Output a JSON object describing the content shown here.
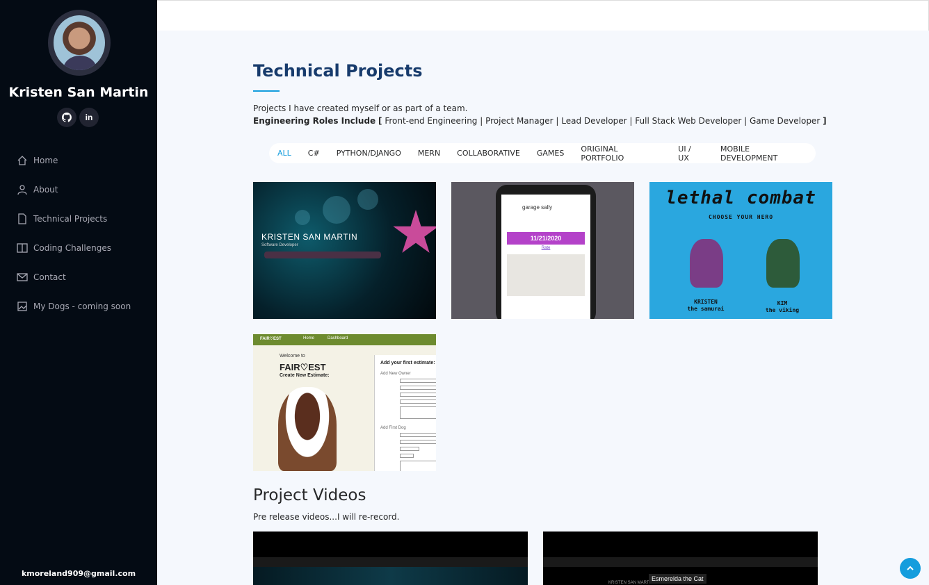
{
  "sidebar": {
    "name": "Kristen San Martin",
    "social": {
      "github": "⌂",
      "linkedin": "in"
    },
    "nav": [
      {
        "label": "Home",
        "icon": "home-icon"
      },
      {
        "label": "About",
        "icon": "person-icon"
      },
      {
        "label": "Technical Projects",
        "icon": "file-icon"
      },
      {
        "label": "Coding Challenges",
        "icon": "book-icon"
      },
      {
        "label": "Contact",
        "icon": "envelope-icon"
      },
      {
        "label": "My Dogs - coming soon",
        "icon": "images-icon"
      }
    ],
    "email": "kmoreland909@gmail.com"
  },
  "main": {
    "title": "Technical Projects",
    "description": "Projects I have created myself or as part of a team.",
    "roles_label": "Engineering Roles Include",
    "roles_text": "Front-end Engineering | Project Manager | Lead Developer | Full Stack Web Developer | Game Developer",
    "filters": [
      "ALL",
      "C#",
      "PYTHON/DJANGO",
      "MERN",
      "COLLABORATIVE",
      "GAMES",
      "ORIGINAL PORTFOLIO",
      "UI / UX",
      "MOBILE DEVELOPMENT"
    ],
    "active_filter": "ALL"
  },
  "projects": {
    "portfolio": {
      "name": "KRISTEN SAN MARTIN",
      "subtitle": "Software Developer"
    },
    "garage": {
      "app": "garage sally",
      "date": "11/21/2020",
      "rate": "Rate"
    },
    "game": {
      "title": "lethal combat",
      "subtitle": "CHOOSE YOUR HERO",
      "hero1": "KRISTEN",
      "hero1_class": "the samurai",
      "hero2": "KIM",
      "hero2_class": "the viking"
    },
    "fairest": {
      "logo": "FAIR♡EST",
      "nav_home": "Home",
      "nav_dash": "Dashboard",
      "welcome": "Welcome to",
      "brand": "FAIR♡EST",
      "create": "Create New Estimate:",
      "form_title": "Add your first estimate:",
      "owner": "Add New Owner",
      "dog": "Add First Dog"
    }
  },
  "videos": {
    "title": "Project Videos",
    "description": "Pre release videos...I will re-record.",
    "tooltip": "Esmerelda the Cat",
    "caption": "KRISTEN SAN MART"
  },
  "colors": {
    "accent": "#149ddd",
    "sidebar": "#040b14",
    "heading": "#173b6c"
  }
}
